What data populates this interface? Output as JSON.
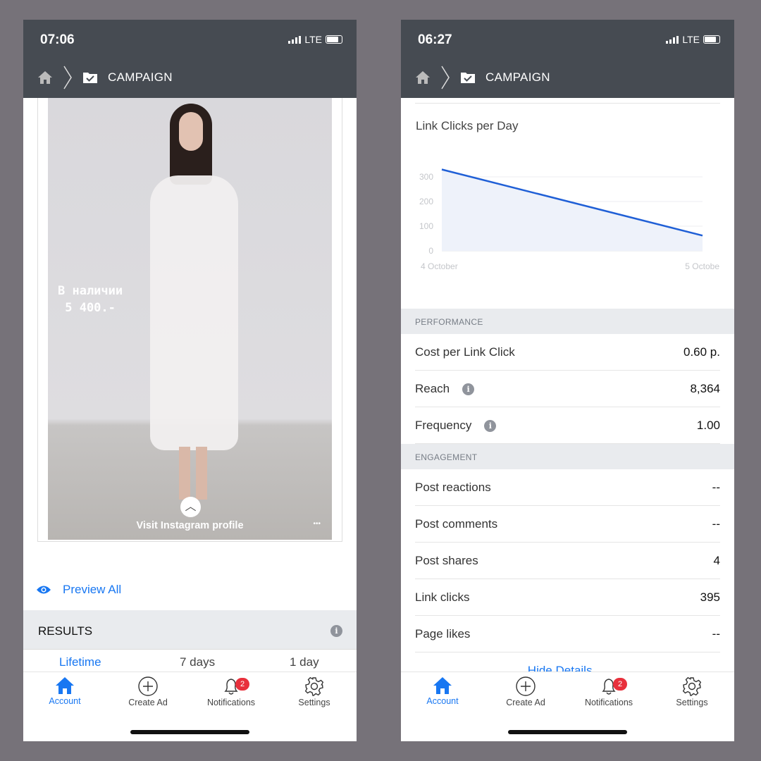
{
  "left": {
    "time": "07:06",
    "network": "LTE",
    "nav_title": "CAMPAIGN",
    "ad": {
      "overlay_line1": "В наличии",
      "overlay_line2": "5 400.-",
      "cta": "Visit Instagram profile",
      "more": "•••"
    },
    "preview_all": "Preview All",
    "results_title": "RESULTS",
    "range_tabs": [
      "Lifetime",
      "7 days",
      "1 day"
    ]
  },
  "right": {
    "time": "06:27",
    "network": "LTE",
    "nav_title": "CAMPAIGN",
    "chart_data": {
      "type": "area",
      "title": "Link Clicks per Day",
      "x": [
        "4 October",
        "5 Octobe"
      ],
      "y": [
        330,
        62
      ],
      "ylim": [
        0,
        400
      ],
      "yticks": [
        "400",
        "300",
        "200",
        "100",
        "0"
      ],
      "color": "#1f5fd6",
      "fill": "#eef2fa",
      "grid": true
    },
    "performance": {
      "header": "PERFORMANCE",
      "rows": [
        {
          "label": "Cost per Link Click",
          "value": "0.60 р.",
          "info": false
        },
        {
          "label": "Reach",
          "value": "8,364",
          "info": true
        },
        {
          "label": "Frequency",
          "value": "1.00",
          "info": true
        }
      ]
    },
    "engagement": {
      "header": "ENGAGEMENT",
      "rows": [
        {
          "label": "Post reactions",
          "value": "--"
        },
        {
          "label": "Post comments",
          "value": "--"
        },
        {
          "label": "Post shares",
          "value": "4"
        },
        {
          "label": "Link clicks",
          "value": "395"
        },
        {
          "label": "Page likes",
          "value": "--"
        }
      ]
    },
    "hide_details": "Hide Details"
  },
  "tabbar": {
    "items": [
      "Account",
      "Create Ad",
      "Notifications",
      "Settings"
    ],
    "badge": "2",
    "active": "Account",
    "accent": "#1877f2"
  }
}
